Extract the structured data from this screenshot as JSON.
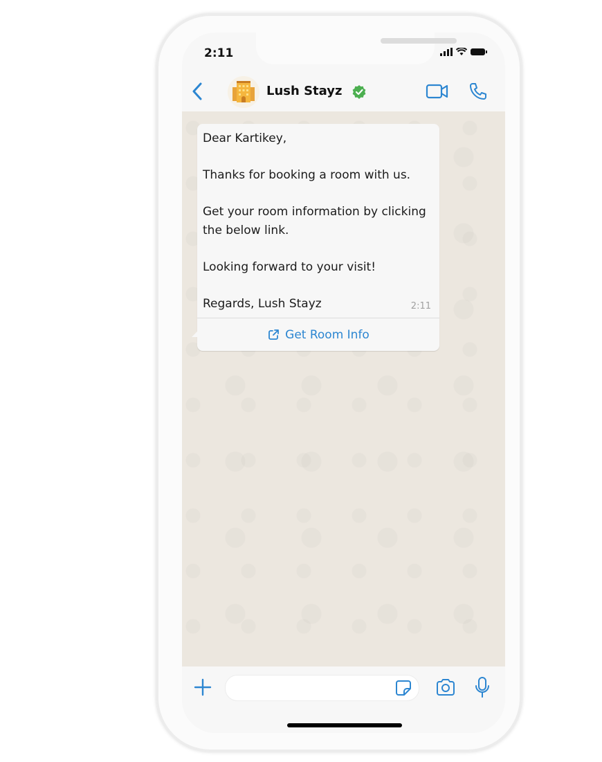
{
  "status_bar": {
    "time": "2:11"
  },
  "header": {
    "title": "Lush Stayz",
    "verified": true
  },
  "message": {
    "text": "Dear Kartikey,\n\nThanks for booking a room with us.\n\nGet your room information by clicking the below link.\n\nLooking forward to your visit!\n\nRegards, Lush Stayz",
    "time": "2:11",
    "button_label": "Get Room Info"
  },
  "composer": {
    "placeholder": ""
  },
  "colors": {
    "accent": "#2c86d1",
    "verified": "#4caf50",
    "chat_bg": "#ece7df"
  }
}
